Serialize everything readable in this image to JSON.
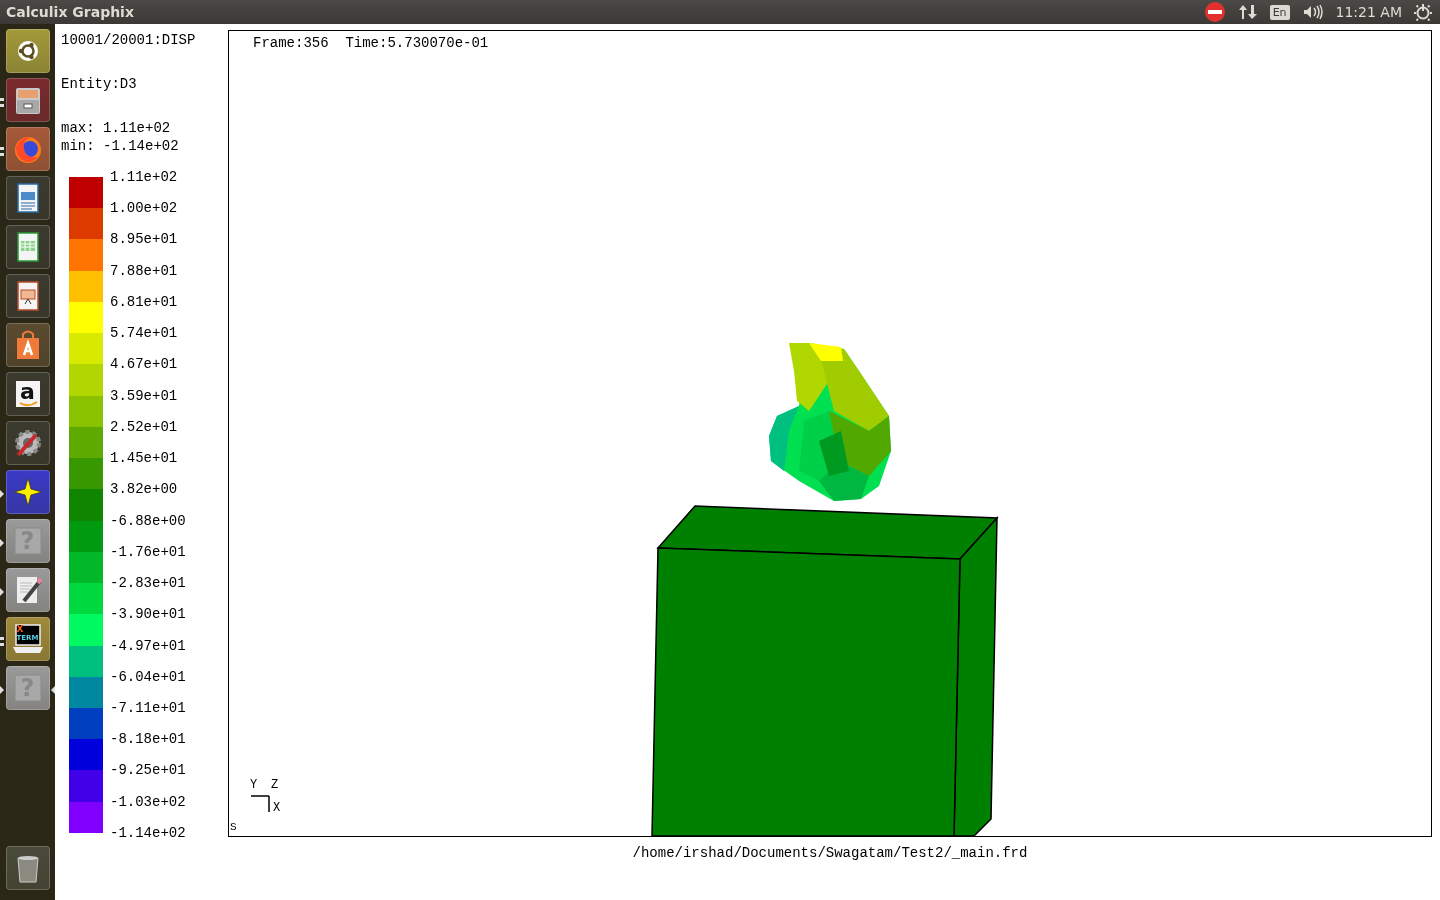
{
  "top_bar": {
    "title": "Calculix Graphix",
    "keyboard_layout": "En",
    "clock": "11:21 AM"
  },
  "launcher": [
    {
      "kind": "ubuntu",
      "running": false,
      "focused": false
    },
    {
      "kind": "files",
      "running": true,
      "multi_window": true,
      "focused": false
    },
    {
      "kind": "firefox",
      "running": true,
      "multi_window": true,
      "focused": false
    },
    {
      "kind": "writer",
      "running": false,
      "focused": false
    },
    {
      "kind": "calc",
      "running": false,
      "focused": false
    },
    {
      "kind": "impress",
      "running": false,
      "focused": false
    },
    {
      "kind": "software",
      "running": false,
      "focused": false
    },
    {
      "kind": "amazon",
      "running": false,
      "focused": false,
      "glyph": "a"
    },
    {
      "kind": "settings",
      "running": false,
      "focused": false
    },
    {
      "kind": "star",
      "running": true,
      "multi_window": false,
      "focused": false
    },
    {
      "kind": "help",
      "running": true,
      "multi_window": false,
      "focused": false,
      "glyph": "?"
    },
    {
      "kind": "editor",
      "running": true,
      "multi_window": false,
      "focused": false
    },
    {
      "kind": "xterm",
      "running": true,
      "multi_window": true,
      "focused": false,
      "glyph": "X",
      "glyph2": "TERM"
    },
    {
      "kind": "help",
      "running": true,
      "multi_window": false,
      "focused": true,
      "glyph": "?"
    },
    {
      "kind": "trash",
      "running": false,
      "focused": false
    }
  ],
  "legend": {
    "dataset": "10001/20001:DISP",
    "entity": "Entity:D3",
    "max": "max: 1.11e+02",
    "min": "min: -1.14e+02",
    "levels": [
      "1.11e+02",
      "1.00e+02",
      "8.95e+01",
      "7.88e+01",
      "6.81e+01",
      "5.74e+01",
      "4.67e+01",
      "3.59e+01",
      "2.52e+01",
      "1.45e+01",
      "3.82e+00",
      "-6.88e+00",
      "-1.76e+01",
      "-2.83e+01",
      "-3.90e+01",
      "-4.97e+01",
      "-6.04e+01",
      "-7.11e+01",
      "-8.18e+01",
      "-9.25e+01",
      "-1.03e+02",
      "-1.14e+02"
    ],
    "bands": [
      {
        "color": "#c00000"
      },
      {
        "color": "#dd3a00"
      },
      {
        "color": "#ff7400"
      },
      {
        "color": "#ffc000"
      },
      {
        "color": "#ffff00"
      },
      {
        "color": "#d8ea00"
      },
      {
        "color": "#b2d600"
      },
      {
        "color": "#8ac200"
      },
      {
        "color": "#5eaa00"
      },
      {
        "color": "#389800"
      },
      {
        "color": "#108600"
      },
      {
        "color": "#009a10"
      },
      {
        "color": "#00b828"
      },
      {
        "color": "#00d840"
      },
      {
        "color": "#00f860"
      },
      {
        "color": "#00c080"
      },
      {
        "color": "#0088a0"
      },
      {
        "color": "#0040c0"
      },
      {
        "color": "#0000dd"
      },
      {
        "color": "#4000e8"
      },
      {
        "color": "#8000ff"
      }
    ]
  },
  "viewport": {
    "frame_info": "Frame:356  Time:5.730070e-01",
    "axis_y": "Y",
    "axis_z": "Z",
    "axis_x": "X",
    "corner_mark": "S"
  },
  "file_path": "/home/irshad/Documents/Swagatam/Test2/_main.frd"
}
